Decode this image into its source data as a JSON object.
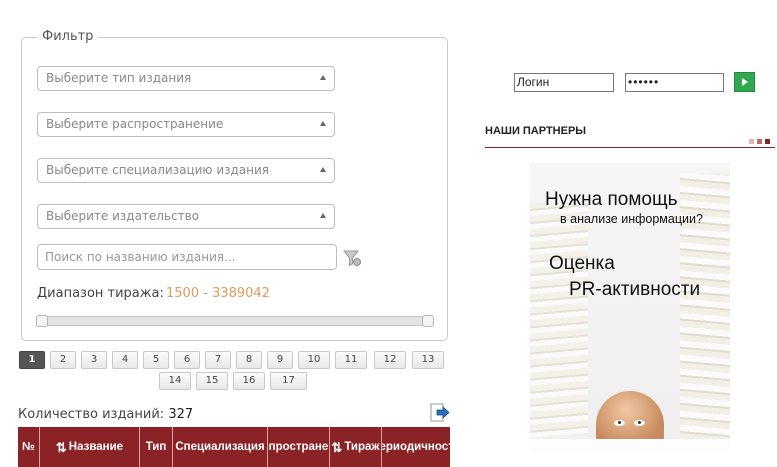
{
  "filter": {
    "legend": "Фильтр",
    "selects": [
      "Выберите тип издания",
      "Выберите распространение",
      "Выберите специализацию издания",
      "Выберите издательство"
    ],
    "search_placeholder": "Поиск по названию издания...",
    "range_label": "Диапазон тиража:",
    "range_value": "1500 - 3389042",
    "range_fill": 1.0
  },
  "pagination": {
    "pages": [
      "1",
      "2",
      "3",
      "4",
      "5",
      "6",
      "7",
      "8",
      "9",
      "10",
      "11",
      "12",
      "13",
      "14",
      "15",
      "16",
      "17"
    ],
    "active": "1"
  },
  "count": {
    "label": "Количество изданий:",
    "value": "327"
  },
  "table": {
    "headers": [
      "№",
      "Название",
      "Тип",
      "Специализация",
      "Распространение",
      "Тираж",
      "Периодичность"
    ]
  },
  "login": {
    "login_value": "Логин",
    "password_value": "••••••"
  },
  "partners": {
    "title": "НАШИ ПАРТНЕРЫ",
    "banner": {
      "line1": "Нужна помощь",
      "line2": "в анализе информации?",
      "line3": "Оценка",
      "line4": "PR-активности"
    }
  },
  "colors": {
    "accent": "#8b2326",
    "range_value": "#e39a5a",
    "go_button": "#2fa84f"
  }
}
